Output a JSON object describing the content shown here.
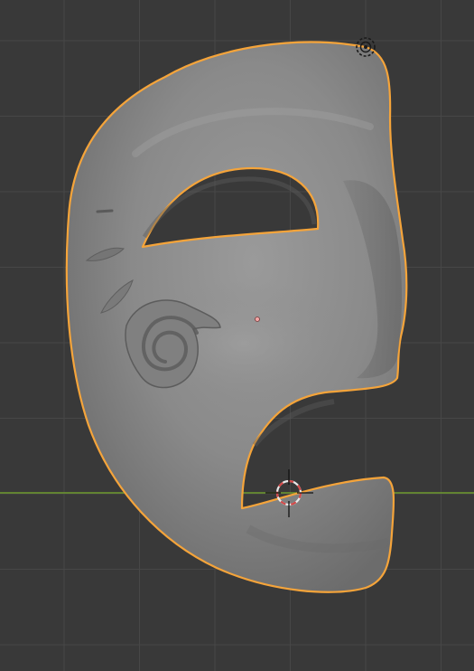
{
  "app": "3D Viewport",
  "viewport": {
    "background_color": "#393939",
    "grid_major_color": "#474747",
    "grid_minor_color": "#404040",
    "x_axis_color": "#6E9A2E",
    "grid_visible": true
  },
  "scene": {
    "selected_object": {
      "semantic": "theatre-mask-mesh",
      "outline_color": "#F5A43A",
      "shading_color": "#8A8A8A",
      "selected": true
    },
    "origin_point_color": "#F3A6A6",
    "light_gizmo_color": "#1A1A1A",
    "cursor_3d": {
      "ring_colors": [
        "#E8E8E8",
        "#D24848"
      ],
      "crosshair_color": "#111111"
    }
  }
}
